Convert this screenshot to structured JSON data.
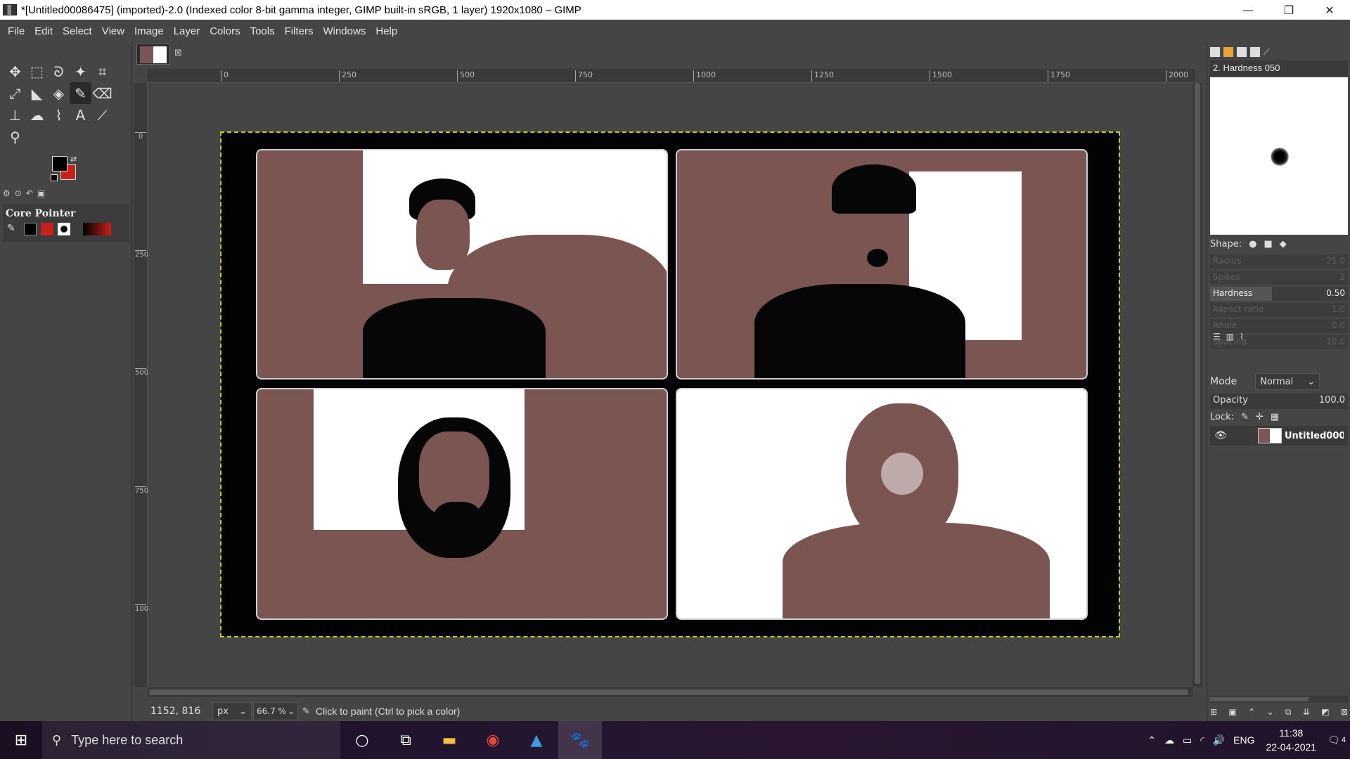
{
  "window": {
    "title": "*[Untitled00086475] (imported)-2.0 (Indexed color 8-bit gamma integer, GIMP built-in sRGB, 1 layer) 1920x1080 – GIMP",
    "minimize": "—",
    "maximize": "❐",
    "close": "✕"
  },
  "menu": [
    "File",
    "Edit",
    "Select",
    "View",
    "Image",
    "Layer",
    "Colors",
    "Tools",
    "Filters",
    "Windows",
    "Help"
  ],
  "toolbox": {
    "tools": [
      {
        "name": "move-tool-icon",
        "glyph": "✥"
      },
      {
        "name": "rect-select-icon",
        "glyph": "⬚"
      },
      {
        "name": "lasso-icon",
        "glyph": "ᘐ"
      },
      {
        "name": "fuzzy-select-icon",
        "glyph": "✦"
      },
      {
        "name": "crop-icon",
        "glyph": "⌗"
      },
      {
        "name": "unified-transform-icon",
        "glyph": "⤢"
      },
      {
        "name": "warp-icon",
        "glyph": "◣"
      },
      {
        "name": "bucket-fill-icon",
        "glyph": "◈"
      },
      {
        "name": "paintbrush-icon",
        "glyph": "✎",
        "active": true
      },
      {
        "name": "eraser-icon",
        "glyph": "⌫"
      },
      {
        "name": "clone-icon",
        "glyph": "⊥"
      },
      {
        "name": "smudge-icon",
        "glyph": "☁"
      },
      {
        "name": "paths-icon",
        "glyph": "⌇"
      },
      {
        "name": "text-tool-icon",
        "glyph": "A"
      },
      {
        "name": "color-picker-icon",
        "glyph": "⟋"
      },
      {
        "name": "zoom-icon",
        "glyph": "⚲"
      }
    ],
    "fg_color": "#000000",
    "bg_color": "#c8201c",
    "device_panel_title": "Core Pointer"
  },
  "rulers": {
    "top": [
      "0",
      "250",
      "500",
      "750",
      "1000",
      "1250",
      "1500",
      "1750",
      "2000"
    ],
    "left": [
      "0",
      "250",
      "500",
      "750",
      "1000"
    ]
  },
  "statusbar": {
    "coords": "1152, 816",
    "unit": "px",
    "zoom": "66.7 %",
    "message": "Click to paint (Ctrl to pick a color)"
  },
  "dock": {
    "brush_name": "2. Hardness 050",
    "shape_label": "Shape:",
    "params": [
      {
        "label": "Radius",
        "value": "25.0",
        "active": false
      },
      {
        "label": "Spikes",
        "value": "2",
        "active": false
      },
      {
        "label": "Hardness",
        "value": "0.50",
        "active": true
      },
      {
        "label": "Aspect ratio",
        "value": "1.0",
        "active": false
      },
      {
        "label": "Angle",
        "value": "0.0",
        "active": false
      },
      {
        "label": "Spacing",
        "value": "10.0",
        "active": false
      }
    ],
    "mode_label": "Mode",
    "mode_value": "Normal",
    "opacity_label": "Opacity",
    "opacity_value": "100.0",
    "lock_label": "Lock:",
    "layer_name": "Untitled000"
  },
  "taskbar": {
    "search_placeholder": "Type here to search",
    "language": "ENG",
    "time": "11:38",
    "date": "22-04-2021",
    "notification_count": "4"
  },
  "colors": {
    "frame_brown": "#7b5552",
    "selection_dash": "#c9c92a"
  }
}
